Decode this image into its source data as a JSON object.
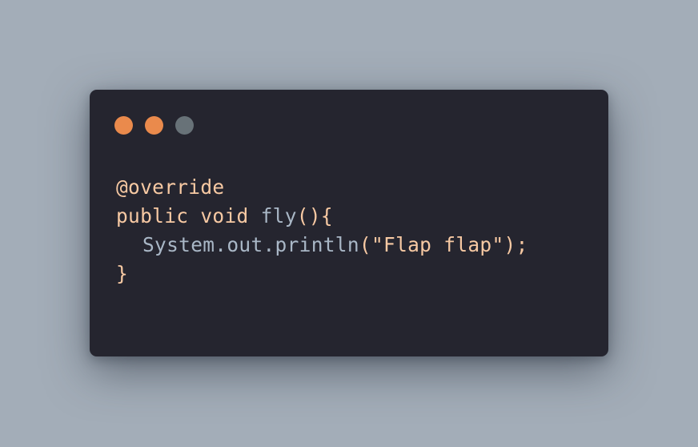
{
  "window": {
    "controls": [
      {
        "name": "close",
        "color": "#ea8a4c"
      },
      {
        "name": "minimize",
        "color": "#ea8a4c"
      },
      {
        "name": "maximize",
        "color": "#687278"
      }
    ]
  },
  "colors": {
    "background": "#a3adb8",
    "window_background": "#25252f",
    "annotation": "#f7c9a3",
    "keyword": "#f7c9a3",
    "method_name": "#a9b7c6",
    "plain": "#a9b7c6",
    "string": "#f7c9a3",
    "punctuation": "#f7c9a3"
  },
  "code": {
    "line1": {
      "annotation": "@override"
    },
    "line2": {
      "keywords": "public void ",
      "method": "fly",
      "punct": "(){"
    },
    "line3": {
      "call": "System.out.println",
      "open": "(",
      "string": "\"Flap flap\"",
      "close": ");"
    },
    "line4": {
      "brace": "}"
    }
  }
}
